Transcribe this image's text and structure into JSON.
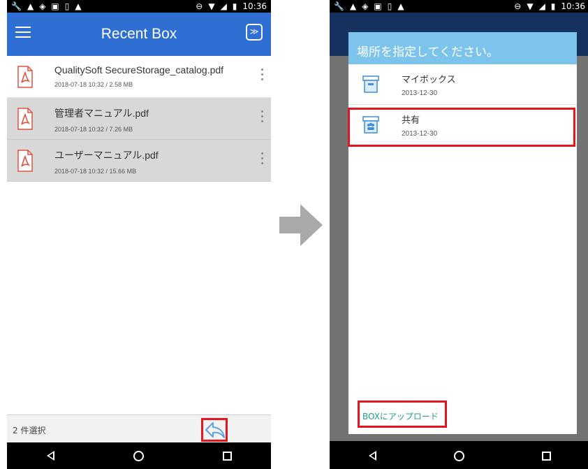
{
  "status_bar": {
    "time": "10:36"
  },
  "screen1": {
    "app_title": "Recent Box",
    "files": [
      {
        "name": "QualitySoft SecureStorage_catalog.pdf",
        "meta": "2018-07-18 10:32 / 2.58 MB",
        "selected": false
      },
      {
        "name": "管理者マニュアル.pdf",
        "meta": "2018-07-18 10:32 / 7.26 MB",
        "selected": true
      },
      {
        "name": "ユーザーマニュアル.pdf",
        "meta": "2018-07-18 10:32 / 15.66 MB",
        "selected": true
      }
    ],
    "selection_count": "2 件選択"
  },
  "screen2": {
    "dialog_title": "場所を指定してください。",
    "boxes": [
      {
        "name": "マイボックス",
        "date": "2013-12-30"
      },
      {
        "name": "共有",
        "date": "2013-12-30"
      }
    ],
    "upload_link": "BOXにアップロード"
  },
  "colors": {
    "app_bar": "#2f6fd3",
    "dialog_header": "#7dc4ec",
    "highlight": "#e3161f",
    "link": "#1e9e8b",
    "pdf_icon": "#e0533e"
  }
}
